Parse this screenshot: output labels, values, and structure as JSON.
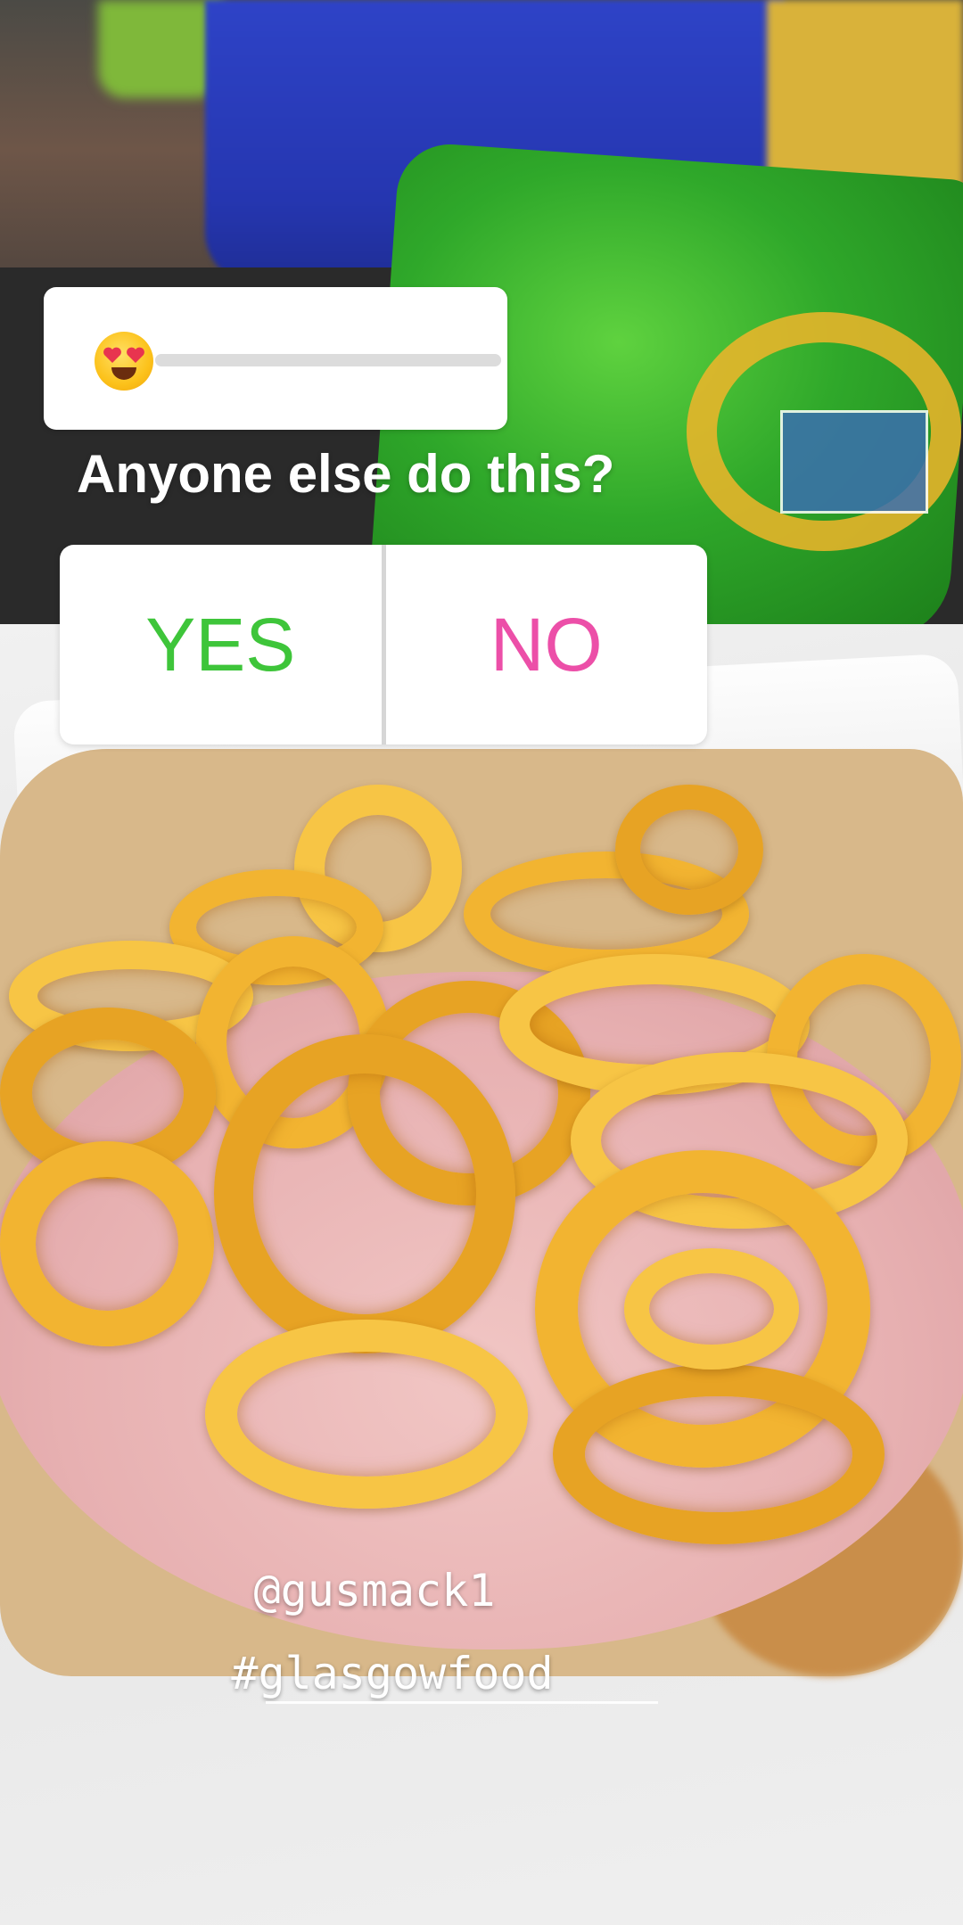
{
  "slider": {
    "emoji_icon": "heart-eyes-emoji",
    "value": 0
  },
  "question": {
    "text": "Anyone else do this?"
  },
  "poll": {
    "yes_label": "YES",
    "no_label": "NO",
    "yes_color": "#3ec53a",
    "no_color": "#ec4fa8"
  },
  "stickers": {
    "mention": "@gusmack1",
    "hashtag": "#glasgowfood"
  }
}
